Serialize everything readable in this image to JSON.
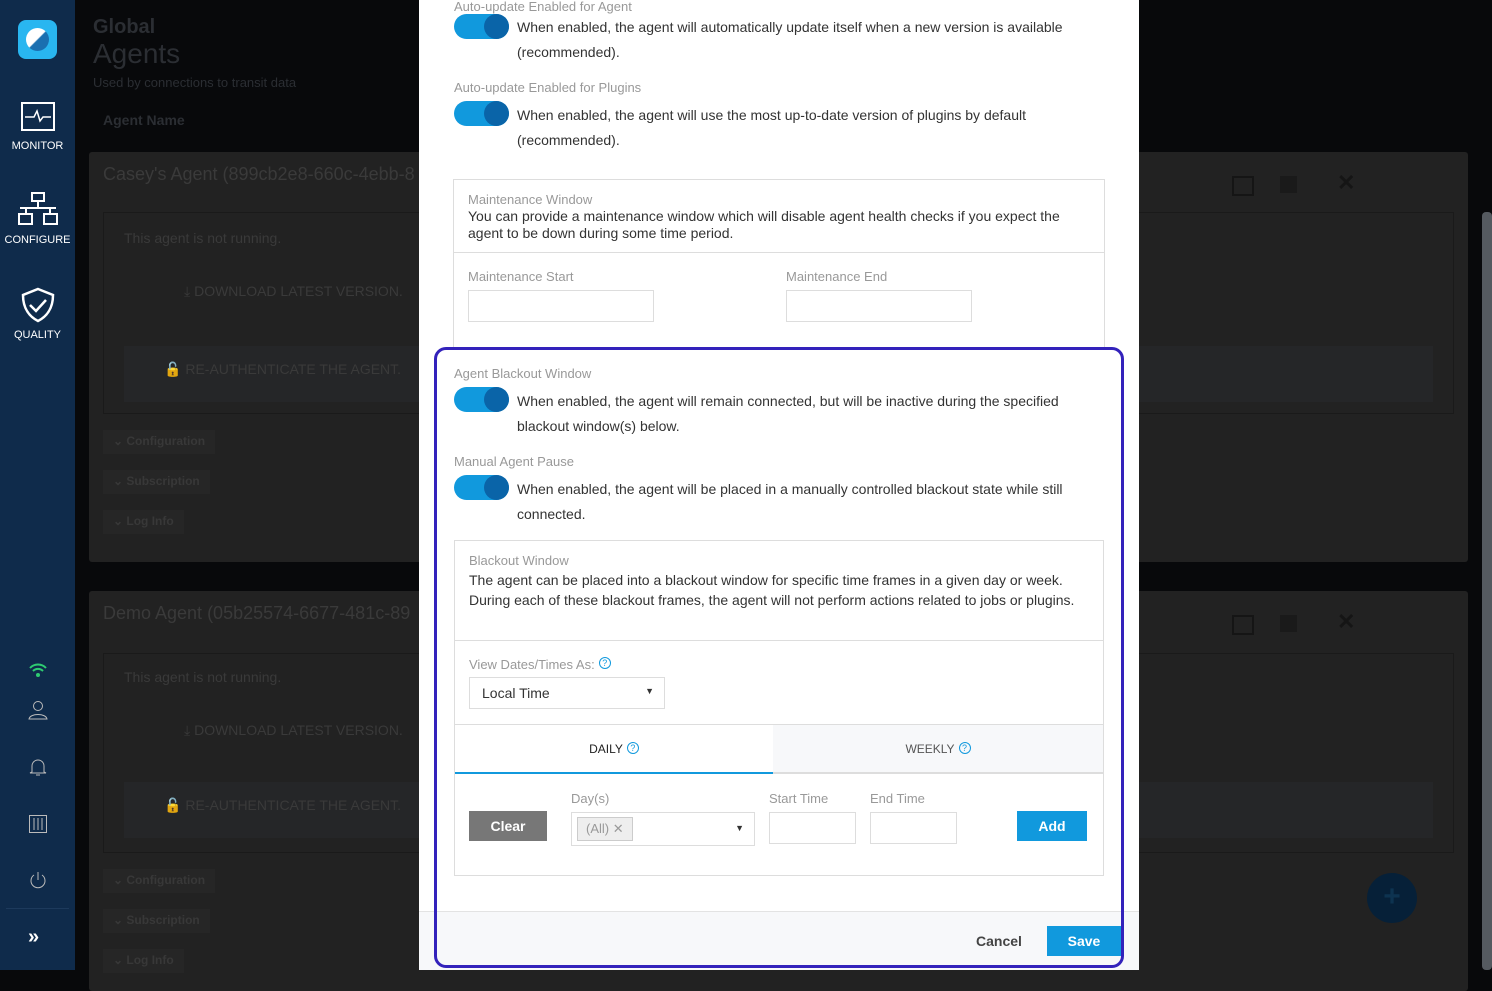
{
  "sidebar": {
    "items": [
      {
        "label": "MONITOR",
        "icon": "monitor-icon"
      },
      {
        "label": "CONFIGURE",
        "icon": "network-icon"
      },
      {
        "label": "QUALITY",
        "icon": "shield-check-icon"
      }
    ],
    "bottom_icons": [
      "wifi-icon",
      "user-icon",
      "bell-icon",
      "sliders-icon",
      "power-icon",
      "expand-icon"
    ],
    "status_color": "#2ecc71"
  },
  "page": {
    "breadcrumb": "Global",
    "title": "Agents",
    "subtitle": "Used by connections to transit data",
    "sort_label": "Agent Name"
  },
  "agents": [
    {
      "name": "Casey's Agent (899cb2e8-660c-4ebb-8",
      "status": "This agent is not running.",
      "download": "DOWNLOAD LATEST VERSION.",
      "reauth": "RE-AUTHENTICATE THE AGENT.",
      "sections": [
        "Configuration",
        "Subscription",
        "Log Info"
      ]
    },
    {
      "name": "Demo Agent (05b25574-6677-481c-89",
      "status": "This agent is not running.",
      "download": "DOWNLOAD LATEST VERSION.",
      "reauth": "RE-AUTHENTICATE THE AGENT.",
      "sections": [
        "Configuration",
        "Subscription",
        "Log Info"
      ]
    }
  ],
  "modal": {
    "auto_agent": {
      "label": "Auto-update Enabled for Agent",
      "enabled": true,
      "text": "When enabled, the agent will automatically update itself when a new version is available (recommended)."
    },
    "auto_plugins": {
      "label": "Auto-update Enabled for Plugins",
      "enabled": true,
      "text": "When enabled, the agent will use the most up-to-date version of plugins by default (recommended)."
    },
    "maintenance": {
      "title": "Maintenance Window",
      "text": "You can provide a maintenance window which will disable agent health checks if you expect the agent to be down during some time period.",
      "start_label": "Maintenance Start",
      "end_label": "Maintenance End",
      "start_value": "",
      "end_value": ""
    },
    "blackout_toggle": {
      "label": "Agent Blackout Window",
      "enabled": true,
      "text": "When enabled, the agent will remain connected, but will be inactive during the specified blackout window(s) below."
    },
    "pause_toggle": {
      "label": "Manual Agent Pause",
      "enabled": true,
      "text": "When enabled, the agent will be placed in a manually controlled blackout state while still connected."
    },
    "blackout": {
      "title": "Blackout Window",
      "text": "The agent can be placed into a blackout window for specific time frames in a given day or week. During each of these blackout frames, the agent will not perform actions related to jobs or plugins.",
      "view_label": "View Dates/Times As:",
      "view_value": "Local Time",
      "tabs": [
        {
          "label": "DAILY",
          "active": true
        },
        {
          "label": "WEEKLY",
          "active": false
        }
      ],
      "clear": "Clear",
      "days_label": "Day(s)",
      "days_chip": "(All)",
      "start_label": "Start Time",
      "end_label": "End Time",
      "add": "Add"
    },
    "cancel": "Cancel",
    "save": "Save"
  },
  "colors": {
    "accent": "#1199dd",
    "highlight": "#3322bb",
    "sidebar": "#0f2b4b"
  }
}
